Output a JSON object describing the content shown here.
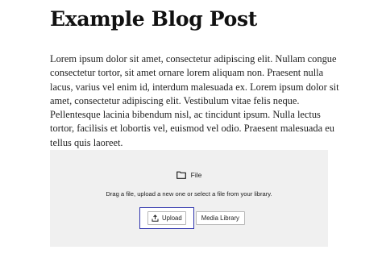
{
  "post": {
    "title": "Example Blog Post",
    "body": "Lorem ipsum dolor sit amet, consectetur adipiscing elit. Nullam congue consectetur tortor, sit amet ornare lorem aliquam non. Praesent nulla lacus, varius vel enim id, interdum malesuada ex. Lorem ipsum dolor sit amet, consectetur adipiscing elit. Vestibulum vitae felis neque.  Pellentesque lacinia bibendum nisl, ac tincidunt ipsum. Nulla lectus  tortor, facilisis et lobortis vel, euismod vel odio. Praesent malesuada  eu tellus quis laoreet."
  },
  "file_block": {
    "icon": "folder-icon",
    "label": "File",
    "instructions": "Drag a file, upload a new one or select a file from your library.",
    "upload_icon": "upload-icon",
    "upload_label": "Upload",
    "media_library_label": "Media Library",
    "focus_color": "#2f35ad",
    "background_color": "#f0f0f0"
  }
}
